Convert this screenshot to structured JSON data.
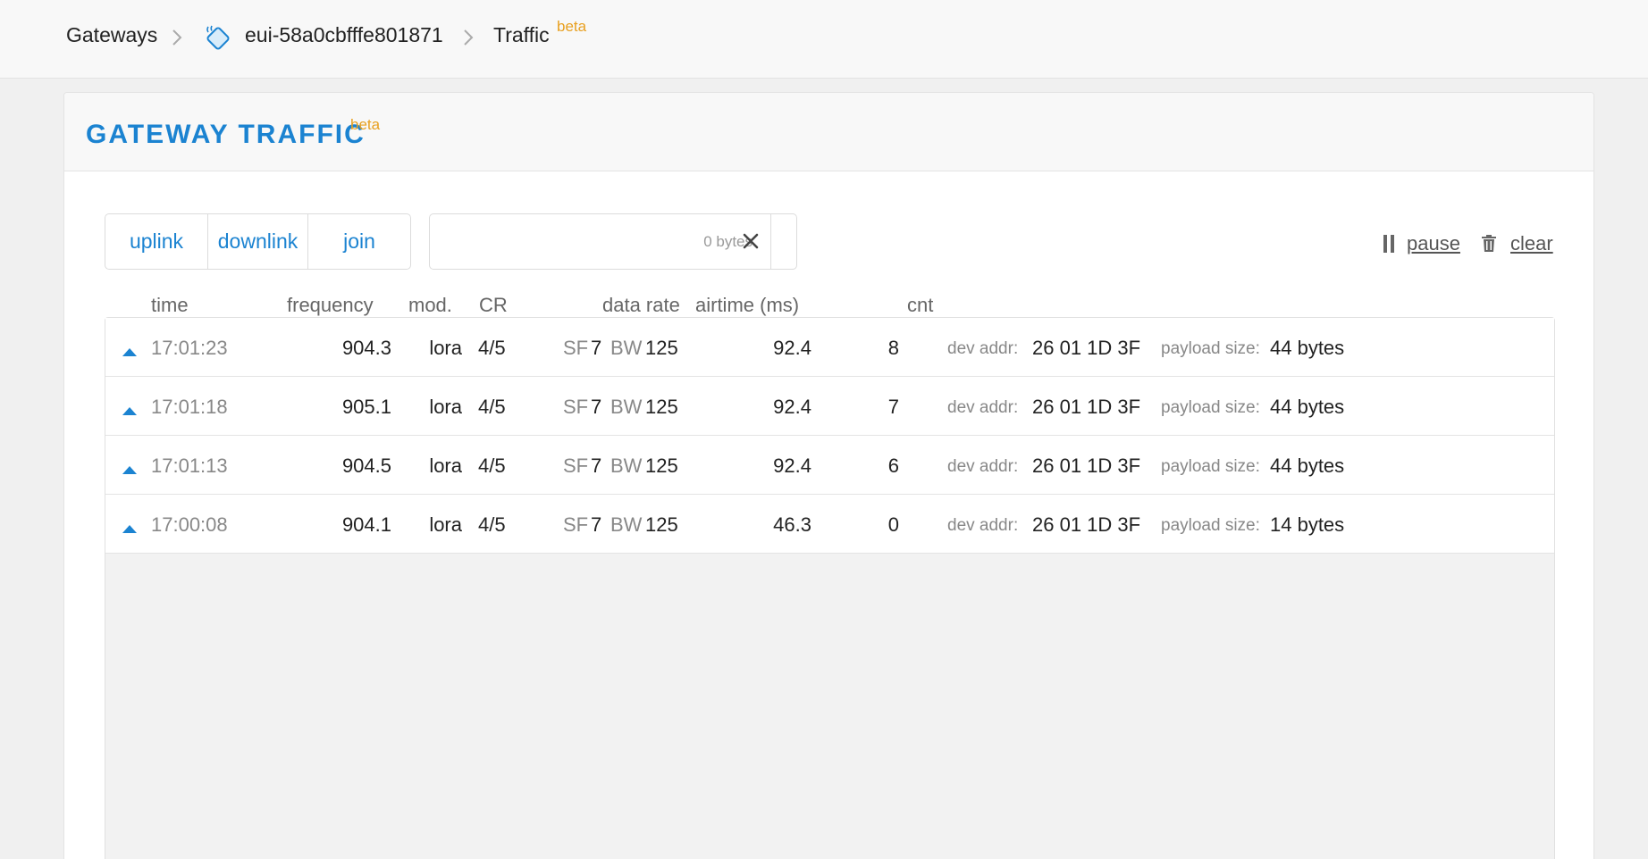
{
  "breadcrumb": {
    "gateways": "Gateways",
    "gateway_id": "eui-58a0cbfffe801871",
    "traffic": "Traffic",
    "traffic_badge": "beta"
  },
  "panel": {
    "title": "GATEWAY TRAFFIC",
    "title_badge": "beta"
  },
  "filters": {
    "uplink": "uplink",
    "downlink": "downlink",
    "join": "join"
  },
  "search": {
    "placeholder": "0 bytes",
    "value": ""
  },
  "actions": {
    "pause": "pause",
    "clear": "clear"
  },
  "columns": {
    "time": "time",
    "frequency": "frequency",
    "mod": "mod.",
    "cr": "CR",
    "data_rate": "data rate",
    "airtime": "airtime (ms)",
    "cnt": "cnt"
  },
  "labels": {
    "sf": "SF",
    "bw": "BW",
    "dev_addr": "dev addr:",
    "payload_size": "payload size:"
  },
  "rows": [
    {
      "direction": "up",
      "time": "17:01:23",
      "frequency": "904.3",
      "mod": "lora",
      "cr": "4/5",
      "sf": "7",
      "bw": "125",
      "airtime": "92.4",
      "cnt": "8",
      "dev_addr": "26 01 1D 3F",
      "payload_size": "44 bytes"
    },
    {
      "direction": "up",
      "time": "17:01:18",
      "frequency": "905.1",
      "mod": "lora",
      "cr": "4/5",
      "sf": "7",
      "bw": "125",
      "airtime": "92.4",
      "cnt": "7",
      "dev_addr": "26 01 1D 3F",
      "payload_size": "44 bytes"
    },
    {
      "direction": "up",
      "time": "17:01:13",
      "frequency": "904.5",
      "mod": "lora",
      "cr": "4/5",
      "sf": "7",
      "bw": "125",
      "airtime": "92.4",
      "cnt": "6",
      "dev_addr": "26 01 1D 3F",
      "payload_size": "44 bytes"
    },
    {
      "direction": "up",
      "time": "17:00:08",
      "frequency": "904.1",
      "mod": "lora",
      "cr": "4/5",
      "sf": "7",
      "bw": "125",
      "airtime": "46.3",
      "cnt": "0",
      "dev_addr": "26 01 1D 3F",
      "payload_size": "14 bytes"
    }
  ],
  "colors": {
    "accent": "#1b83d1",
    "beta": "#e8a020"
  }
}
